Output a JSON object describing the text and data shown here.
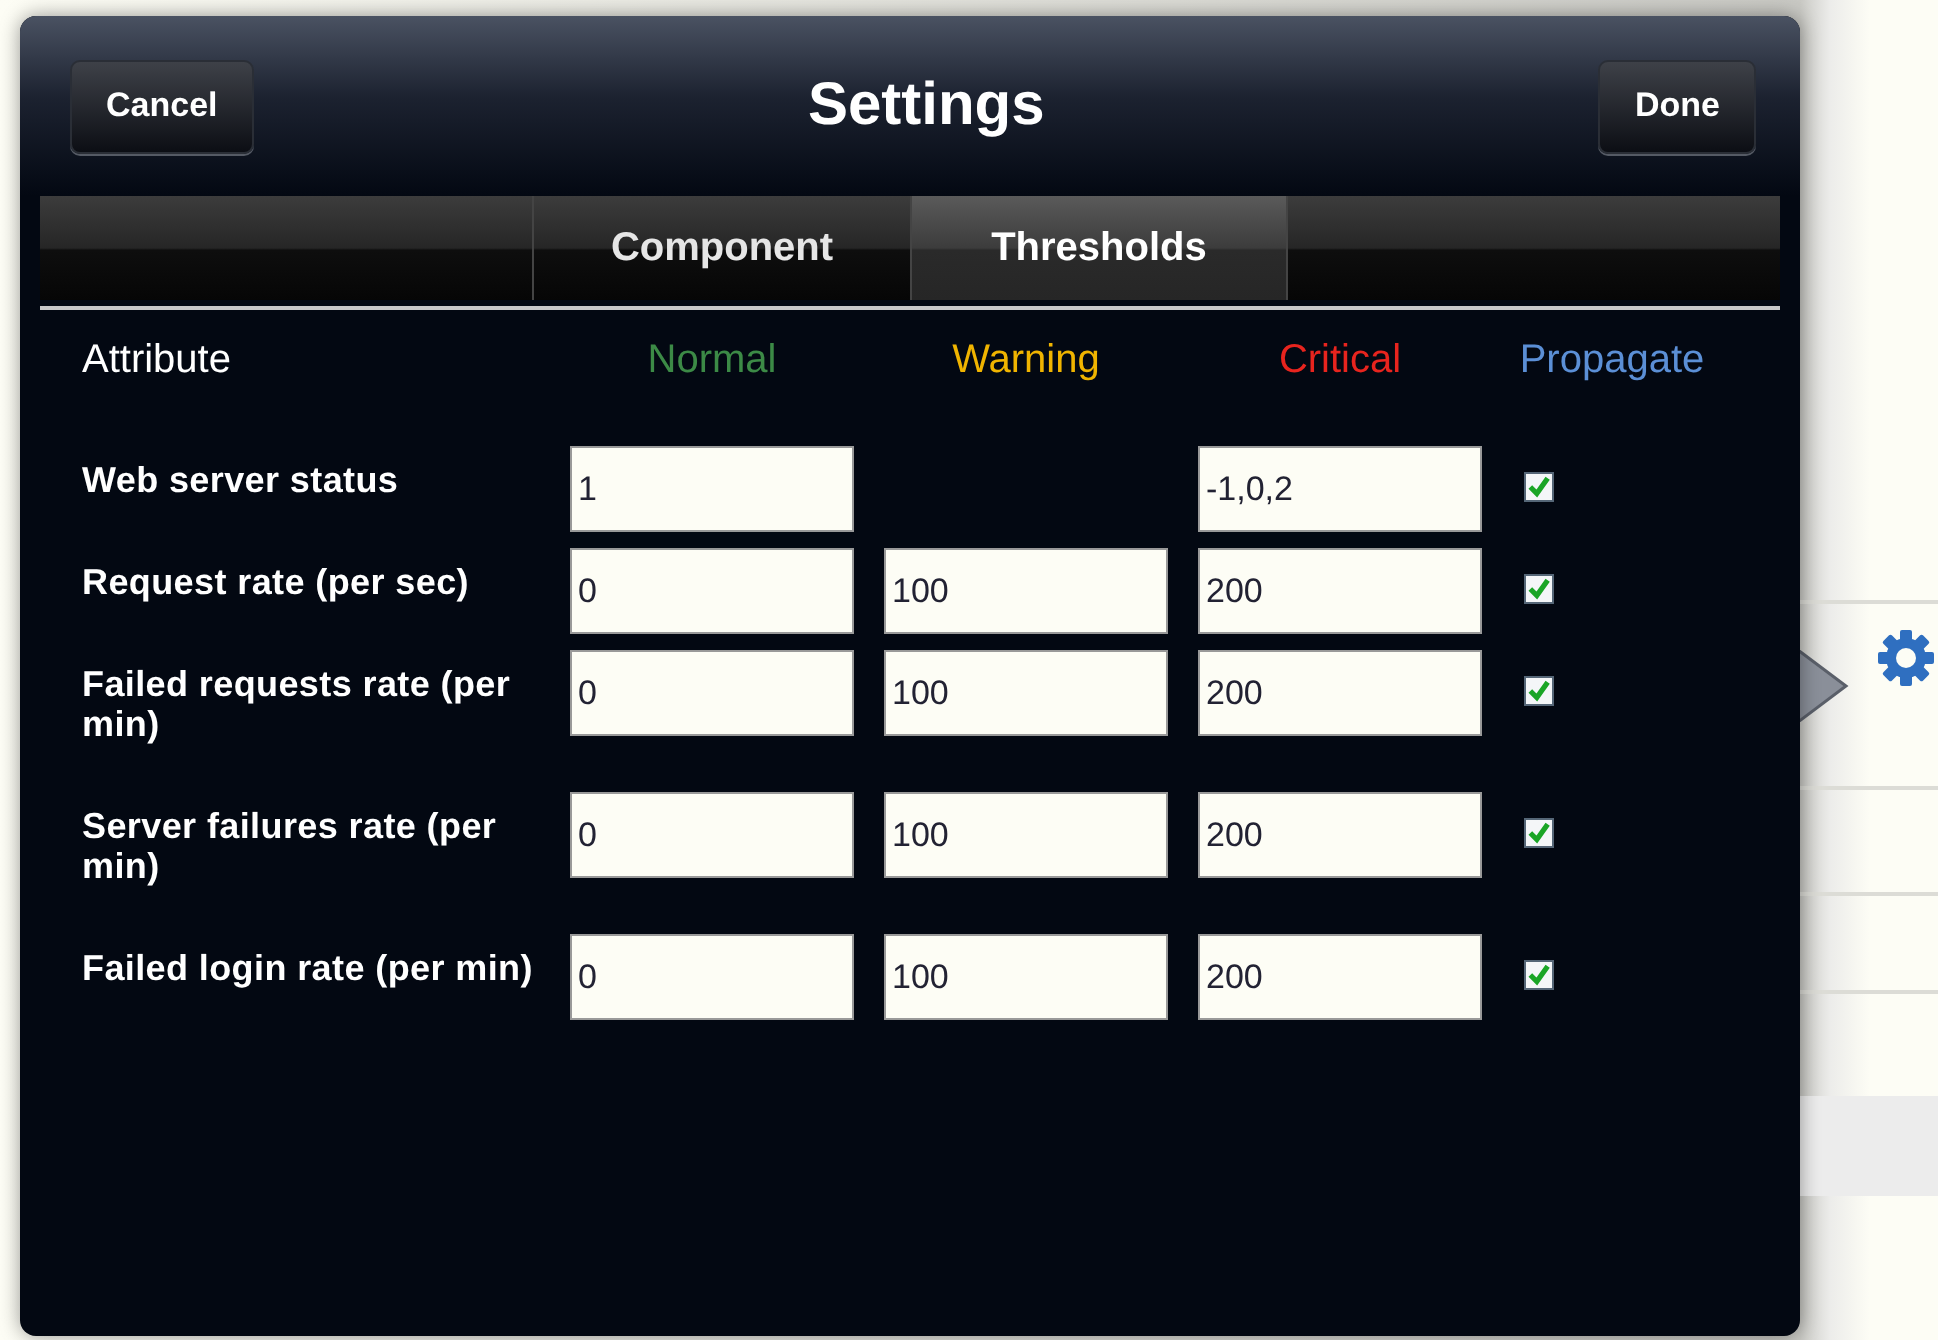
{
  "dialog": {
    "title": "Settings",
    "cancel_button": "Cancel",
    "done_button": "Done"
  },
  "tabs": [
    {
      "label": "Component",
      "selected": false
    },
    {
      "label": "Thresholds",
      "selected": true
    }
  ],
  "columns": [
    {
      "label": "Attribute",
      "color": "#ffffff"
    },
    {
      "label": "Normal",
      "color": "#3c8a46"
    },
    {
      "label": "Warning",
      "color": "#f0b400"
    },
    {
      "label": "Critical",
      "color": "#e8241e"
    },
    {
      "label": "Propagate",
      "color": "#5b8fd6"
    }
  ],
  "rows": [
    {
      "attribute": "Web server status",
      "normal": "1",
      "critical": "-1,0,2",
      "propagate": true
    },
    {
      "attribute": "Request rate (per sec)",
      "normal": "0",
      "warning": "100",
      "critical": "200",
      "propagate": true
    },
    {
      "attribute": "Failed requests rate (per min)",
      "normal": "0",
      "warning": "100",
      "critical": "200",
      "propagate": true
    },
    {
      "attribute": "Server failures rate (per min)",
      "normal": "0",
      "warning": "100",
      "critical": "200",
      "propagate": true
    },
    {
      "attribute": "Failed login rate (per min)",
      "normal": "0",
      "warning": "100",
      "critical": "200",
      "propagate": true
    }
  ]
}
